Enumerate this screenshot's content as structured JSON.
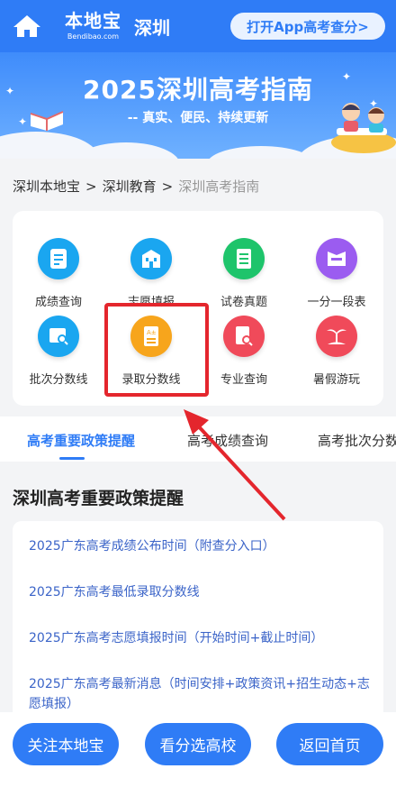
{
  "header": {
    "logo_main": "本地宝",
    "logo_sub": "Bendibao.com",
    "city": "深圳",
    "app_button": "打开App高考查分>"
  },
  "banner": {
    "title": "2025深圳高考指南",
    "subtitle": "-- 真实、便民、持续更新"
  },
  "breadcrumb": {
    "items": [
      "深圳本地宝",
      "深圳教育",
      "深圳高考指南"
    ],
    "separator": ">"
  },
  "grid": {
    "items": [
      {
        "label": "成绩查询",
        "icon": "document-icon",
        "color": "#1aa6f0"
      },
      {
        "label": "志愿填报",
        "icon": "building-icon",
        "color": "#1aa6f0"
      },
      {
        "label": "试卷真题",
        "icon": "exam-paper-icon",
        "color": "#1ec46b"
      },
      {
        "label": "一分一段表",
        "icon": "score-table-icon",
        "color": "#9b5cf0"
      },
      {
        "label": "批次分数线",
        "icon": "batch-search-icon",
        "color": "#1aa6f0"
      },
      {
        "label": "录取分数线",
        "icon": "score-line-icon",
        "color": "#f7a51c"
      },
      {
        "label": "专业查询",
        "icon": "major-search-icon",
        "color": "#f04a5a"
      },
      {
        "label": "暑假游玩",
        "icon": "palm-tree-icon",
        "color": "#f04a5a"
      }
    ],
    "highlight_color": "#e4262d"
  },
  "tabs": {
    "items": [
      "高考重要政策提醒",
      "高考成绩查询",
      "高考批次分数"
    ],
    "active": "高考重要政策提醒"
  },
  "section": {
    "title": "深圳高考重要政策提醒",
    "items": [
      "2025广东高考成绩公布时间（附查分入口）",
      "2025广东高考最低录取分数线",
      "2025广东高考志愿填报时间（开始时间+截止时间）",
      "2025广东高考最新消息（时间安排+政策资讯+招生动态+志愿填报）"
    ]
  },
  "bottom": {
    "follow": "关注本地宝",
    "pick_school": "看分选高校",
    "home": "返回首页"
  },
  "colors": {
    "primary": "#2f7cf6",
    "link": "#3b64c8",
    "annotation": "#e4262d"
  }
}
